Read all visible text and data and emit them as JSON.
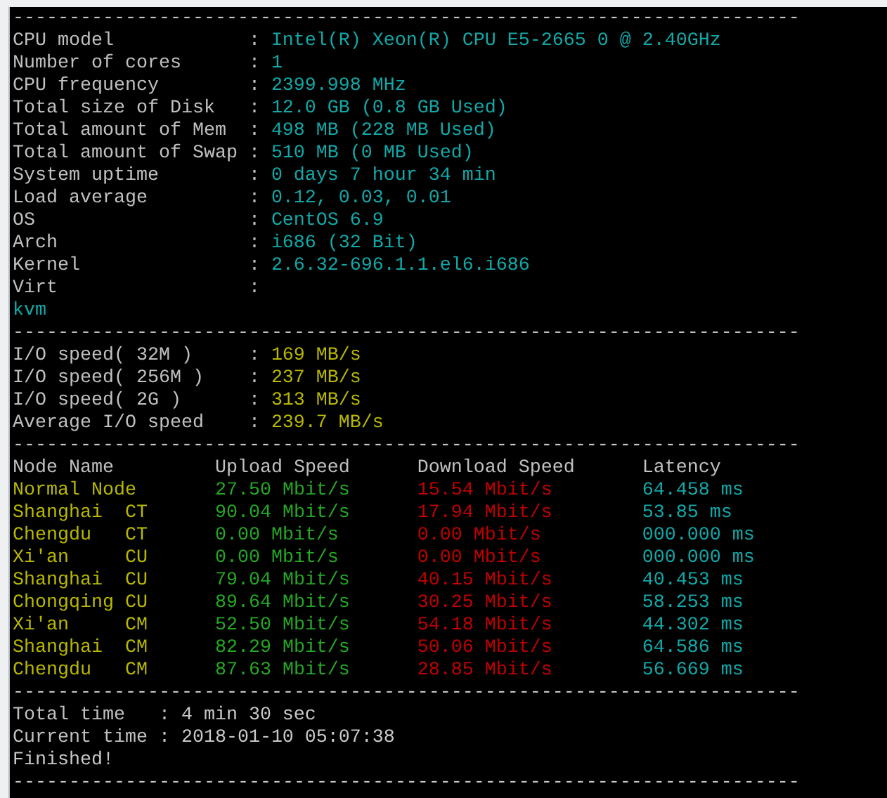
{
  "terminal": {
    "delimiter": ":",
    "blocks": [
      {
        "kind": "rule",
        "text": "----------------------------------------------------------------------"
      },
      {
        "kind": "info",
        "rows": [
          {
            "label": "CPU model",
            "value": "Intel(R) Xeon(R) CPU E5-2665 0 @ 2.40GHz"
          },
          {
            "label": "Number of cores",
            "value": "1"
          },
          {
            "label": "CPU frequency",
            "value": "2399.998 MHz"
          },
          {
            "label": "Total size of Disk",
            "value": "12.0 GB (0.8 GB Used)"
          },
          {
            "label": "Total amount of Mem",
            "value": "498 MB (228 MB Used)"
          },
          {
            "label": "Total amount of Swap",
            "value": "510 MB (0 MB Used)"
          },
          {
            "label": "System uptime",
            "value": "0 days 7 hour 34 min"
          },
          {
            "label": "Load average",
            "value": "0.12, 0.03, 0.01"
          },
          {
            "label": "OS",
            "value": "CentOS 6.9"
          },
          {
            "label": "Arch",
            "value": "i686 (32 Bit)"
          },
          {
            "label": "Kernel",
            "value": "2.6.32-696.1.1.el6.i686"
          },
          {
            "label": "Virt"
          }
        ]
      },
      {
        "kind": "value_line",
        "text": "kvm"
      },
      {
        "kind": "rule",
        "text": "----------------------------------------------------------------------"
      },
      {
        "kind": "io",
        "rows": [
          {
            "label": "I/O speed( 32M )",
            "value": "169 MB/s"
          },
          {
            "label": "I/O speed( 256M )",
            "value": "237 MB/s"
          },
          {
            "label": "I/O speed( 2G )",
            "value": "313 MB/s"
          },
          {
            "label": "Average I/O speed",
            "value": "239.7 MB/s"
          }
        ]
      },
      {
        "kind": "rule",
        "text": "----------------------------------------------------------------------"
      },
      {
        "kind": "speed_table",
        "columns": [
          "Node Name",
          "Upload Speed",
          "Download Speed",
          "Latency"
        ],
        "rows": [
          {
            "node": "Normal Node",
            "upload": "27.50 Mbit/s",
            "download": "15.54 Mbit/s",
            "latency": "64.458 ms"
          },
          {
            "node": "Shanghai",
            "isp": "CT",
            "upload": "90.04 Mbit/s",
            "download": "17.94 Mbit/s",
            "latency": "53.85 ms"
          },
          {
            "node": "Chengdu",
            "isp": "CT",
            "upload": "0.00 Mbit/s",
            "download": "0.00 Mbit/s",
            "latency": "000.000 ms"
          },
          {
            "node": "Xi'an",
            "isp": "CU",
            "upload": "0.00 Mbit/s",
            "download": "0.00 Mbit/s",
            "latency": "000.000 ms"
          },
          {
            "node": "Shanghai",
            "isp": "CU",
            "upload": "79.04 Mbit/s",
            "download": "40.15 Mbit/s",
            "latency": "40.453 ms"
          },
          {
            "node": "Chongqing",
            "isp": "CU",
            "upload": "89.64 Mbit/s",
            "download": "30.25 Mbit/s",
            "latency": "58.253 ms"
          },
          {
            "node": "Xi'an",
            "isp": "CM",
            "upload": "52.50 Mbit/s",
            "download": "54.18 Mbit/s",
            "latency": "44.302 ms"
          },
          {
            "node": "Shanghai",
            "isp": "CM",
            "upload": "82.29 Mbit/s",
            "download": "50.06 Mbit/s",
            "latency": "64.586 ms"
          },
          {
            "node": "Chengdu",
            "isp": "CM",
            "upload": "87.63 Mbit/s",
            "download": "28.85 Mbit/s",
            "latency": "56.669 ms"
          }
        ]
      },
      {
        "kind": "rule",
        "text": "----------------------------------------------------------------------"
      },
      {
        "kind": "summary",
        "rows": [
          {
            "label": "Total time",
            "value": "4 min 30 sec"
          },
          {
            "label": "Current time",
            "value": "2018-01-10 05:07:38"
          }
        ]
      },
      {
        "kind": "plain_line",
        "text": "Finished!"
      },
      {
        "kind": "rule",
        "text": "----------------------------------------------------------------------"
      }
    ]
  }
}
